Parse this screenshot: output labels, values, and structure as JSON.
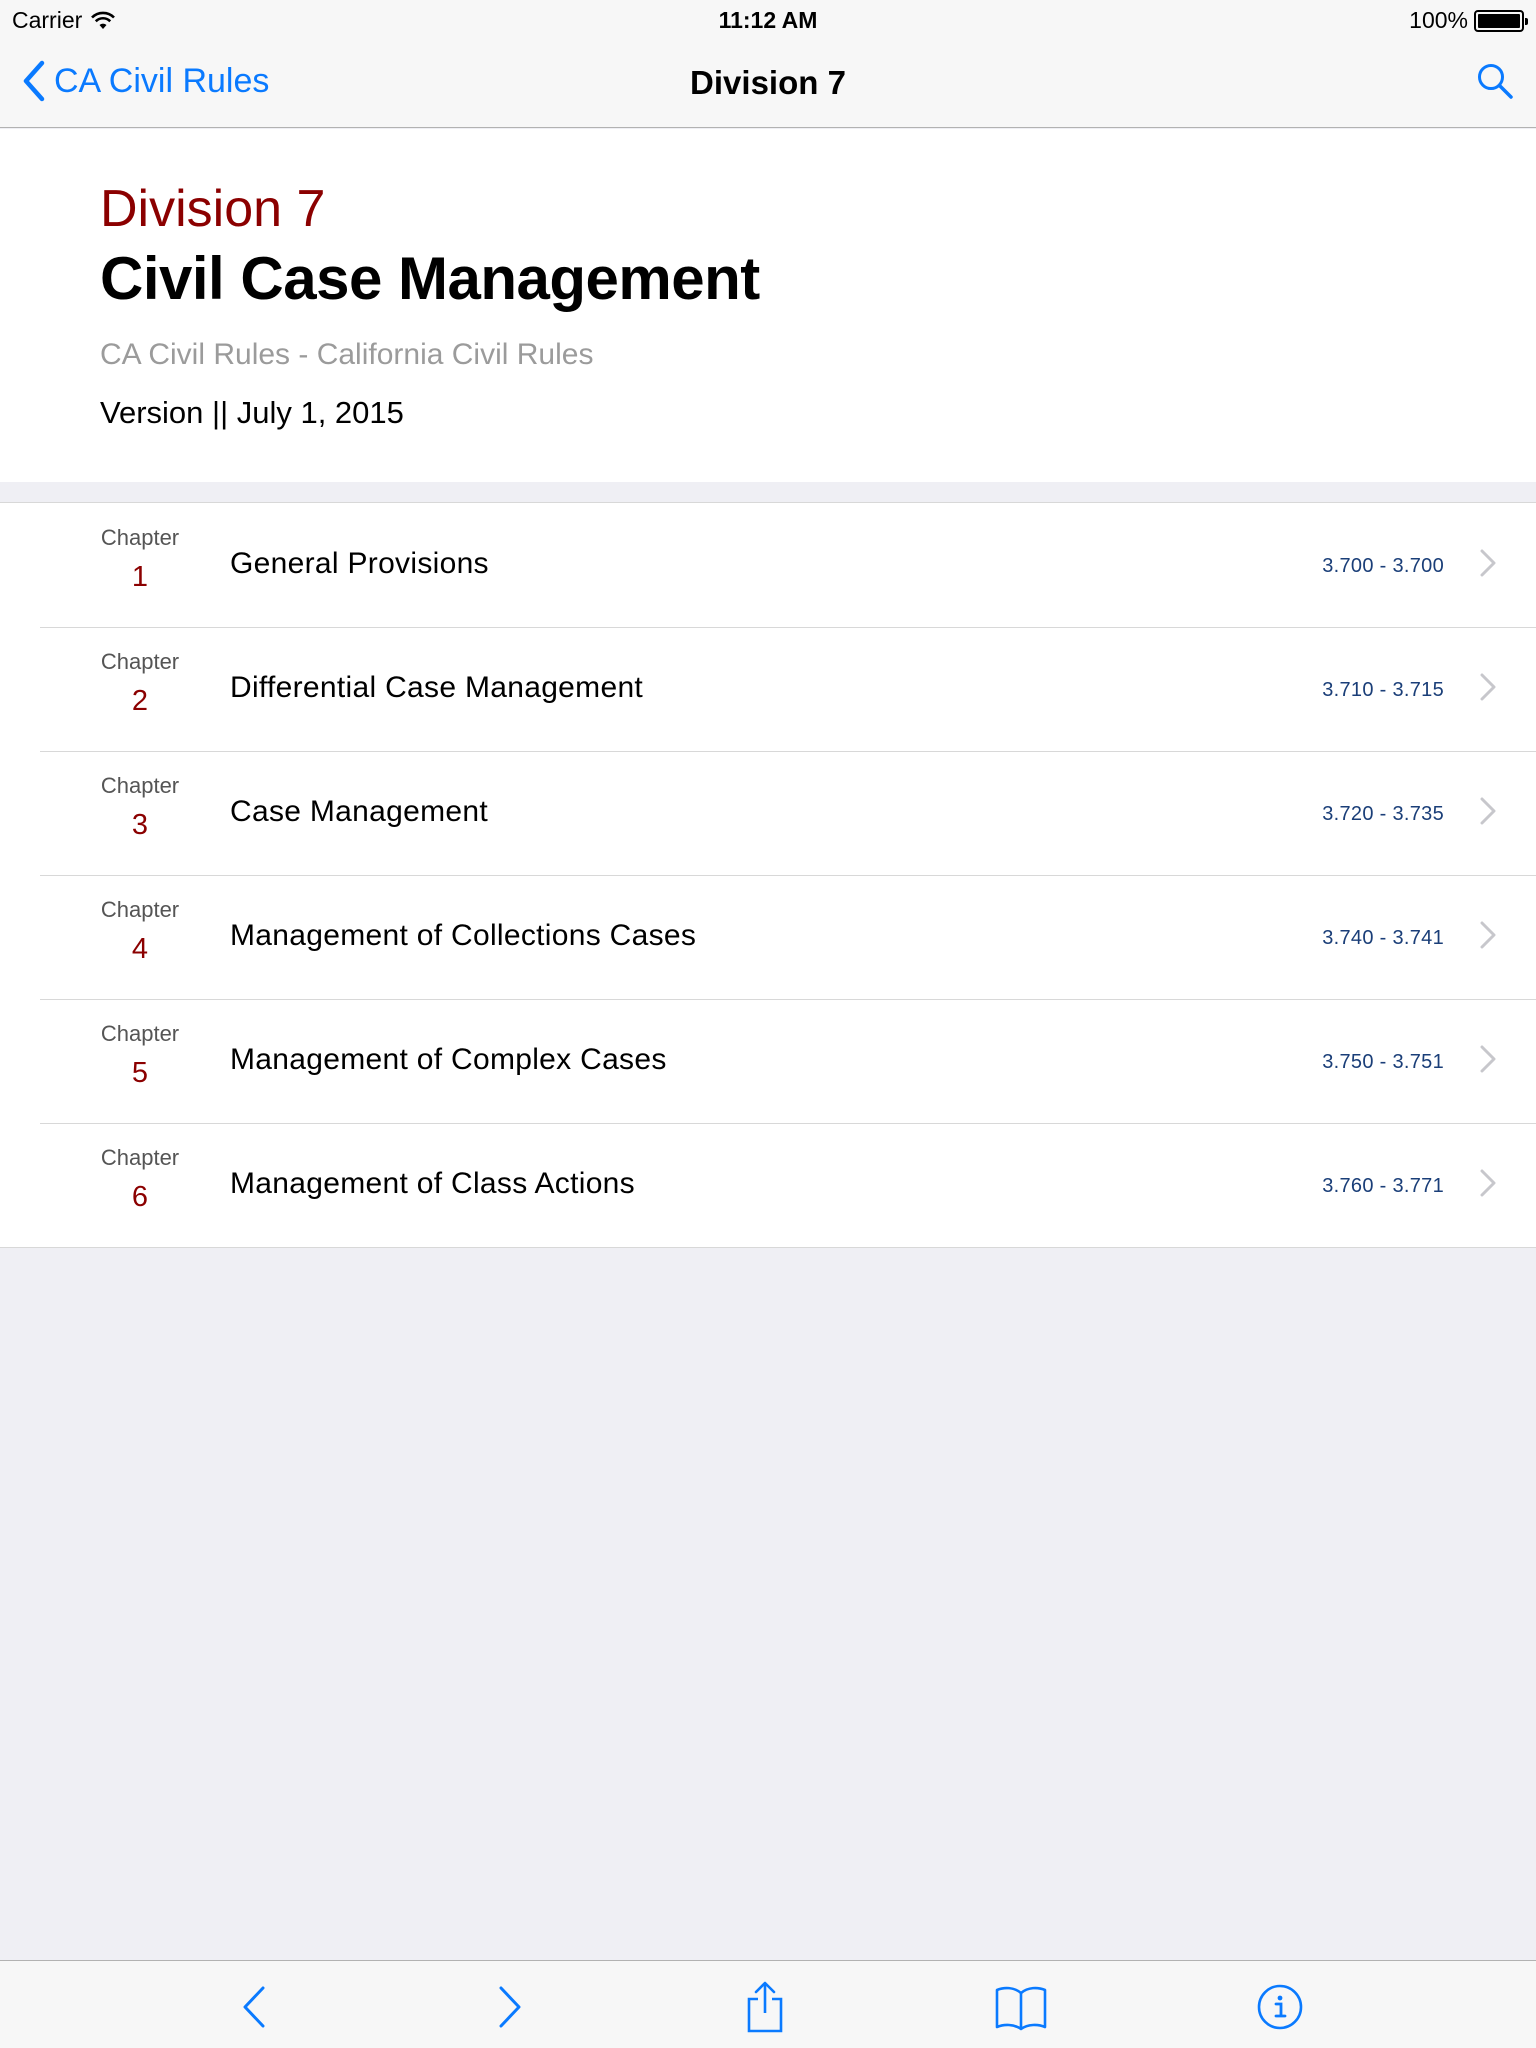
{
  "status_bar": {
    "carrier": "Carrier",
    "time": "11:12 AM",
    "battery": "100%"
  },
  "nav": {
    "back_label": "CA Civil Rules",
    "title": "Division 7"
  },
  "header": {
    "division_label": "Division 7",
    "division_name": "Civil Case Management",
    "book_subtitle": "CA Civil Rules - California Civil Rules",
    "version": "Version || July 1, 2015"
  },
  "chapters": [
    {
      "word": "Chapter",
      "number": "1",
      "title": "General Provisions",
      "range": "3.700 - 3.700"
    },
    {
      "word": "Chapter",
      "number": "2",
      "title": "Differential Case Management",
      "range": "3.710 - 3.715"
    },
    {
      "word": "Chapter",
      "number": "3",
      "title": "Case Management",
      "range": "3.720 - 3.735"
    },
    {
      "word": "Chapter",
      "number": "4",
      "title": "Management of Collections Cases",
      "range": "3.740 - 3.741"
    },
    {
      "word": "Chapter",
      "number": "5",
      "title": "Management of Complex Cases",
      "range": "3.750 - 3.751"
    },
    {
      "word": "Chapter",
      "number": "6",
      "title": "Management of Class Actions",
      "range": "3.760 - 3.771"
    }
  ],
  "toolbar": {
    "icons": [
      "back-arrow-icon",
      "forward-arrow-icon",
      "share-icon",
      "bookmarks-icon",
      "info-icon"
    ]
  },
  "colors": {
    "tint": "#0a7aff",
    "accent_red": "#8b0000",
    "range_blue": "#1a3e78",
    "background": "#efeff4"
  }
}
